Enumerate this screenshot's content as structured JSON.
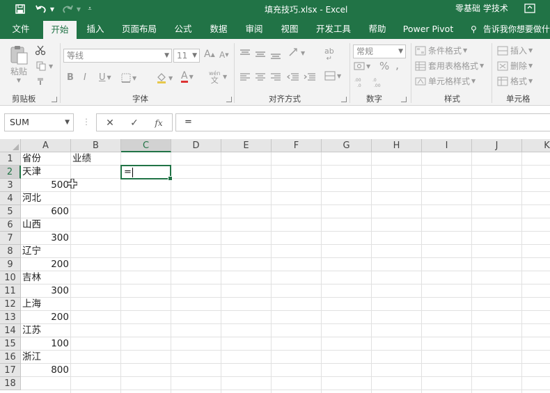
{
  "window": {
    "title": "填充技巧.xlsx  -  Excel",
    "user": "零基础 学技术"
  },
  "ribbon_tabs": [
    {
      "label": "文件",
      "active": false
    },
    {
      "label": "开始",
      "active": true
    },
    {
      "label": "插入",
      "active": false
    },
    {
      "label": "页面布局",
      "active": false
    },
    {
      "label": "公式",
      "active": false
    },
    {
      "label": "数据",
      "active": false
    },
    {
      "label": "审阅",
      "active": false
    },
    {
      "label": "视图",
      "active": false
    },
    {
      "label": "开发工具",
      "active": false
    },
    {
      "label": "帮助",
      "active": false
    },
    {
      "label": "Power Pivot",
      "active": false
    }
  ],
  "tell_me": "告诉我你想要做什",
  "ribbon": {
    "clipboard": {
      "group": "剪贴板",
      "paste": "粘贴"
    },
    "font": {
      "group": "字体",
      "font_name": "等线",
      "font_size": "11",
      "bold": "B",
      "italic": "I",
      "underline": "U",
      "grow": "A",
      "shrink": "A",
      "font_color": "A",
      "phonetic_top": "wén",
      "phonetic_bottom": "文"
    },
    "alignment": {
      "group": "对齐方式",
      "wrap": "ab"
    },
    "number": {
      "group": "数字",
      "format": "常规",
      "percent": "%",
      "comma": ","
    },
    "styles": {
      "group": "样式",
      "conditional": "条件格式",
      "table": "套用表格格式",
      "cell_styles": "单元格样式"
    },
    "cells": {
      "group": "单元格",
      "insert": "插入",
      "delete": "删除",
      "format": "格式"
    }
  },
  "formula_bar": {
    "name_box": "SUM",
    "fx": "fx",
    "content": "="
  },
  "sheet": {
    "columns": [
      "A",
      "B",
      "C",
      "D",
      "E",
      "F",
      "G",
      "H",
      "I",
      "J",
      "K"
    ],
    "selected_column": "C",
    "rows": [
      "1",
      "2",
      "3",
      "4",
      "5",
      "6",
      "7",
      "8",
      "9",
      "10",
      "11",
      "12",
      "13",
      "14",
      "15",
      "16",
      "17",
      "18"
    ],
    "selected_row": "2",
    "cells": {
      "A1": "省份",
      "B1": "业绩",
      "A2": "天津",
      "A3": "500",
      "A4": "河北",
      "A5": "600",
      "A6": "山西",
      "A7": "300",
      "A8": "辽宁",
      "A9": "200",
      "A10": "吉林",
      "A11": "300",
      "A12": "上海",
      "A13": "200",
      "A14": "江苏",
      "A15": "100",
      "A16": "浙江",
      "A17": "800"
    },
    "active_cell": "C2",
    "active_cell_content": "="
  }
}
